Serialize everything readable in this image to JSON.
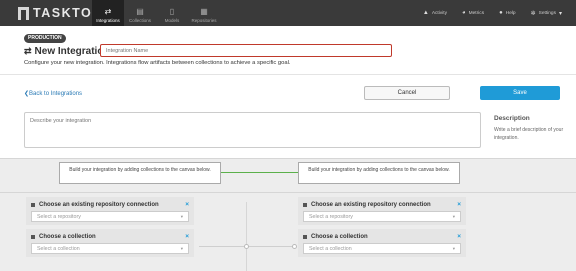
{
  "nav": {
    "logo": "TASKTOP",
    "tabs": [
      {
        "label": "Integrations",
        "icon": "integrations-icon",
        "active": true
      },
      {
        "label": "Collections",
        "icon": "collections-icon",
        "active": false
      },
      {
        "label": "Models",
        "icon": "models-icon",
        "active": false
      },
      {
        "label": "Repositories",
        "icon": "repositories-icon",
        "active": false
      }
    ],
    "right": [
      {
        "label": "Activity",
        "icon": "activity-icon"
      },
      {
        "label": "Metrics",
        "icon": "metrics-icon"
      },
      {
        "label": "Help",
        "icon": "help-icon"
      },
      {
        "label": "Settings",
        "icon": "settings-icon"
      }
    ]
  },
  "header": {
    "badge": "PRODUCTION",
    "title": "New Integration",
    "name_placeholder": "Integration Name",
    "subtitle": "Configure your new integration. Integrations flow artifacts between collections to achieve a specific goal."
  },
  "actions": {
    "back": "Back to Integrations",
    "cancel": "Cancel",
    "save": "Save"
  },
  "description": {
    "placeholder": "Describe your integration",
    "side_title": "Description",
    "side_text": "Write a brief description of your integration."
  },
  "canvas": {
    "prompt": "Build your integration by adding collections to the canvas below.",
    "left": {
      "repo_title": "Choose an existing repository connection",
      "repo_placeholder": "Select a repository",
      "collection_title": "Choose a collection",
      "collection_placeholder": "Select a collection"
    },
    "right": {
      "repo_title": "Choose an existing repository connection",
      "repo_placeholder": "Select a repository",
      "collection_title": "Choose a collection",
      "collection_placeholder": "Select a collection"
    }
  },
  "colors": {
    "nav_bg": "#3a3a3a",
    "accent": "#1f9bd7",
    "link": "#2a7ab5",
    "error_border": "#c0392b",
    "connector": "#5bb04b"
  }
}
